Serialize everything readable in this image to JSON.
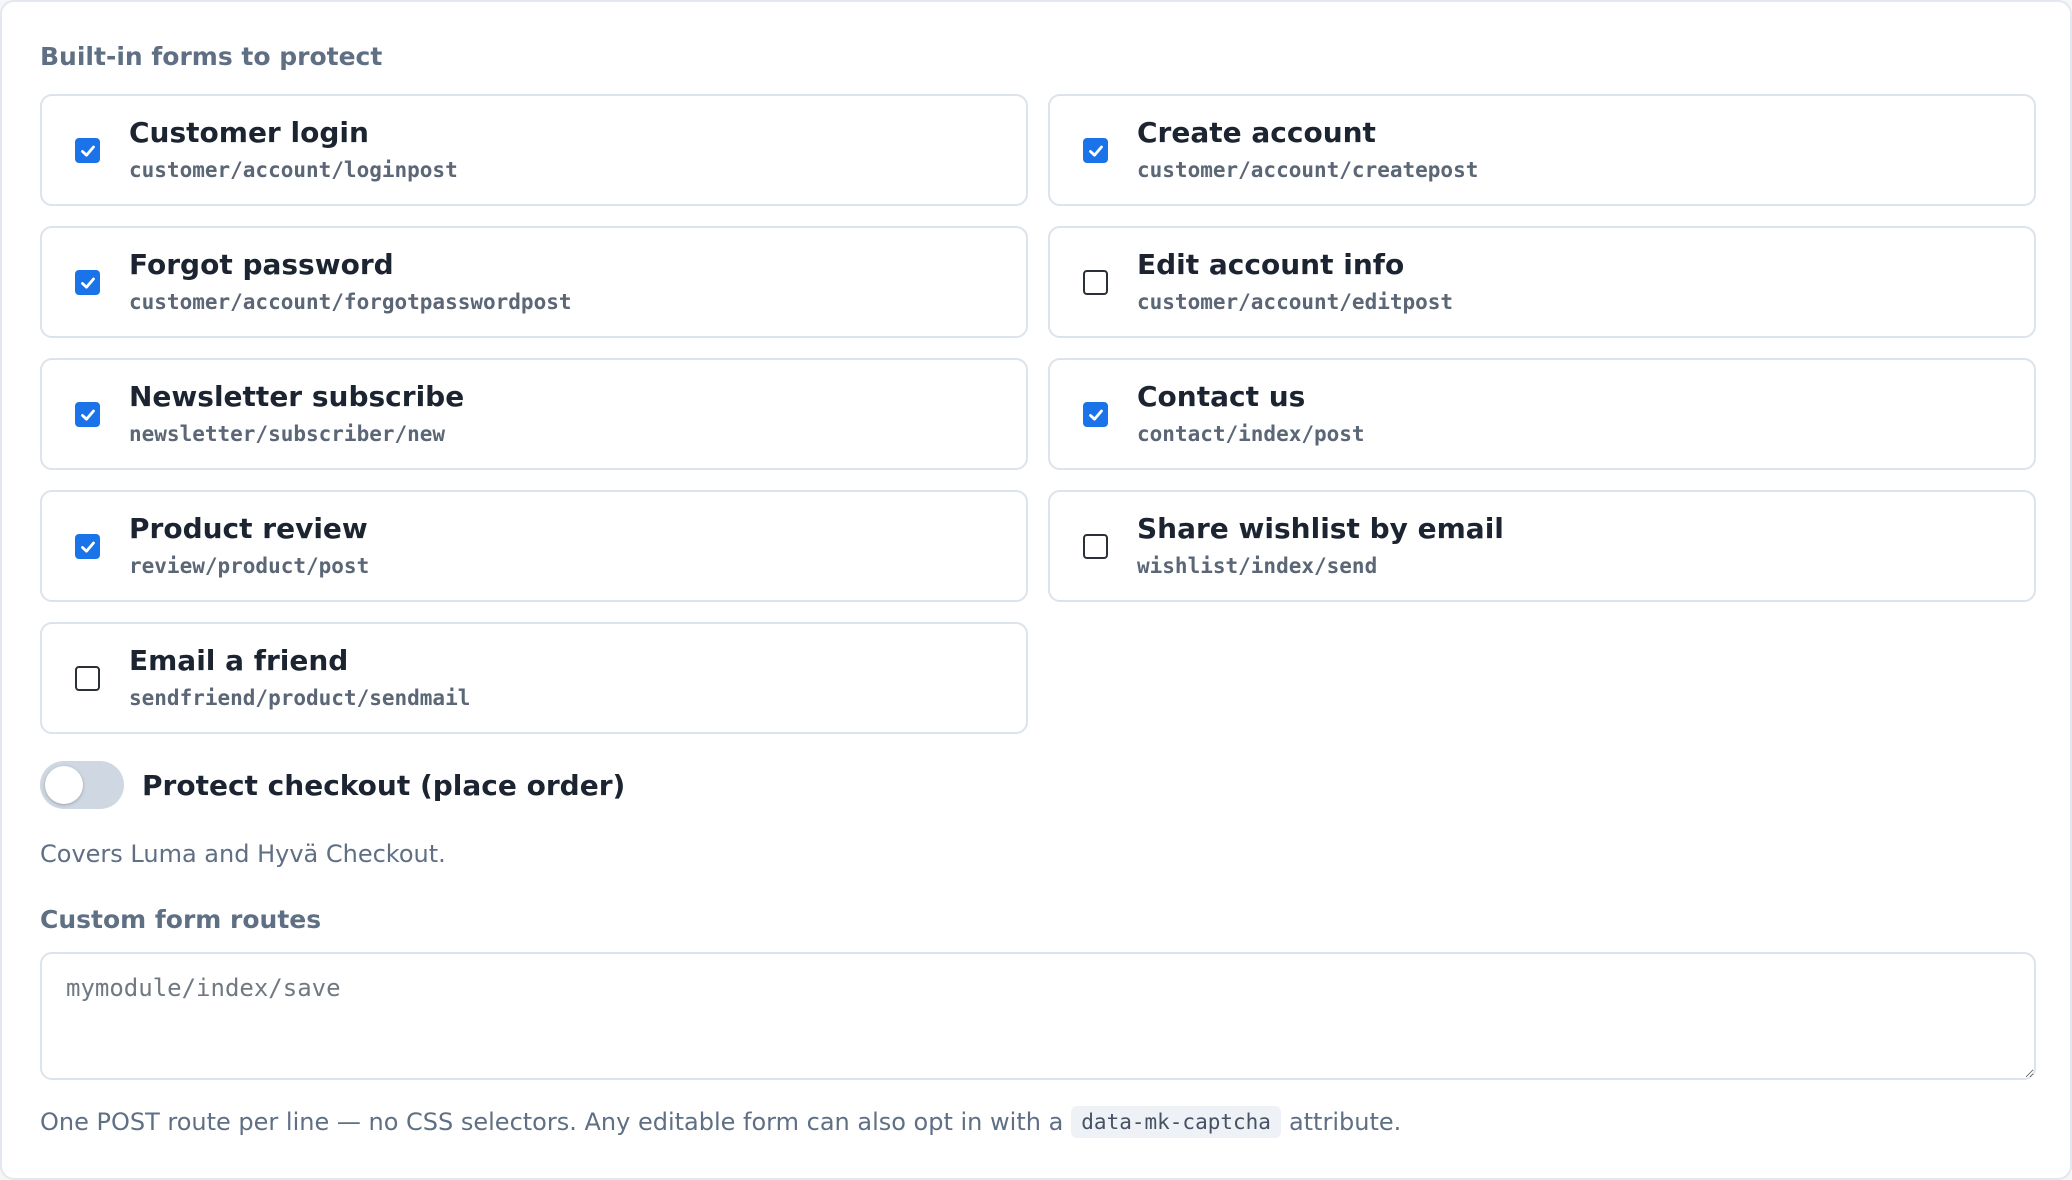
{
  "builtin": {
    "title": "Built-in forms to protect",
    "forms": [
      {
        "label": "Customer login",
        "route": "customer/account/loginpost",
        "checked": true
      },
      {
        "label": "Create account",
        "route": "customer/account/createpost",
        "checked": true
      },
      {
        "label": "Forgot password",
        "route": "customer/account/forgotpasswordpost",
        "checked": true
      },
      {
        "label": "Edit account info",
        "route": "customer/account/editpost",
        "checked": false
      },
      {
        "label": "Newsletter subscribe",
        "route": "newsletter/subscriber/new",
        "checked": true
      },
      {
        "label": "Contact us",
        "route": "contact/index/post",
        "checked": true
      },
      {
        "label": "Product review",
        "route": "review/product/post",
        "checked": true
      },
      {
        "label": "Share wishlist by email",
        "route": "wishlist/index/send",
        "checked": false
      },
      {
        "label": "Email a friend",
        "route": "sendfriend/product/sendmail",
        "checked": false
      }
    ]
  },
  "checkout": {
    "label": "Protect checkout (place order)",
    "enabled": false,
    "hint": "Covers Luma and Hyvä Checkout."
  },
  "custom_routes": {
    "title": "Custom form routes",
    "value": "",
    "placeholder": "mymodule/index/save",
    "hint_before": "One POST route per line — no CSS selectors. Any editable form can also opt in with a",
    "hint_code": "data-mk-captcha",
    "hint_after": "attribute."
  },
  "colors": {
    "accent": "#1a73e8",
    "muted_text": "#5f6f84",
    "card_border": "#dde3ea",
    "toggle_off": "#cfd7e2"
  }
}
